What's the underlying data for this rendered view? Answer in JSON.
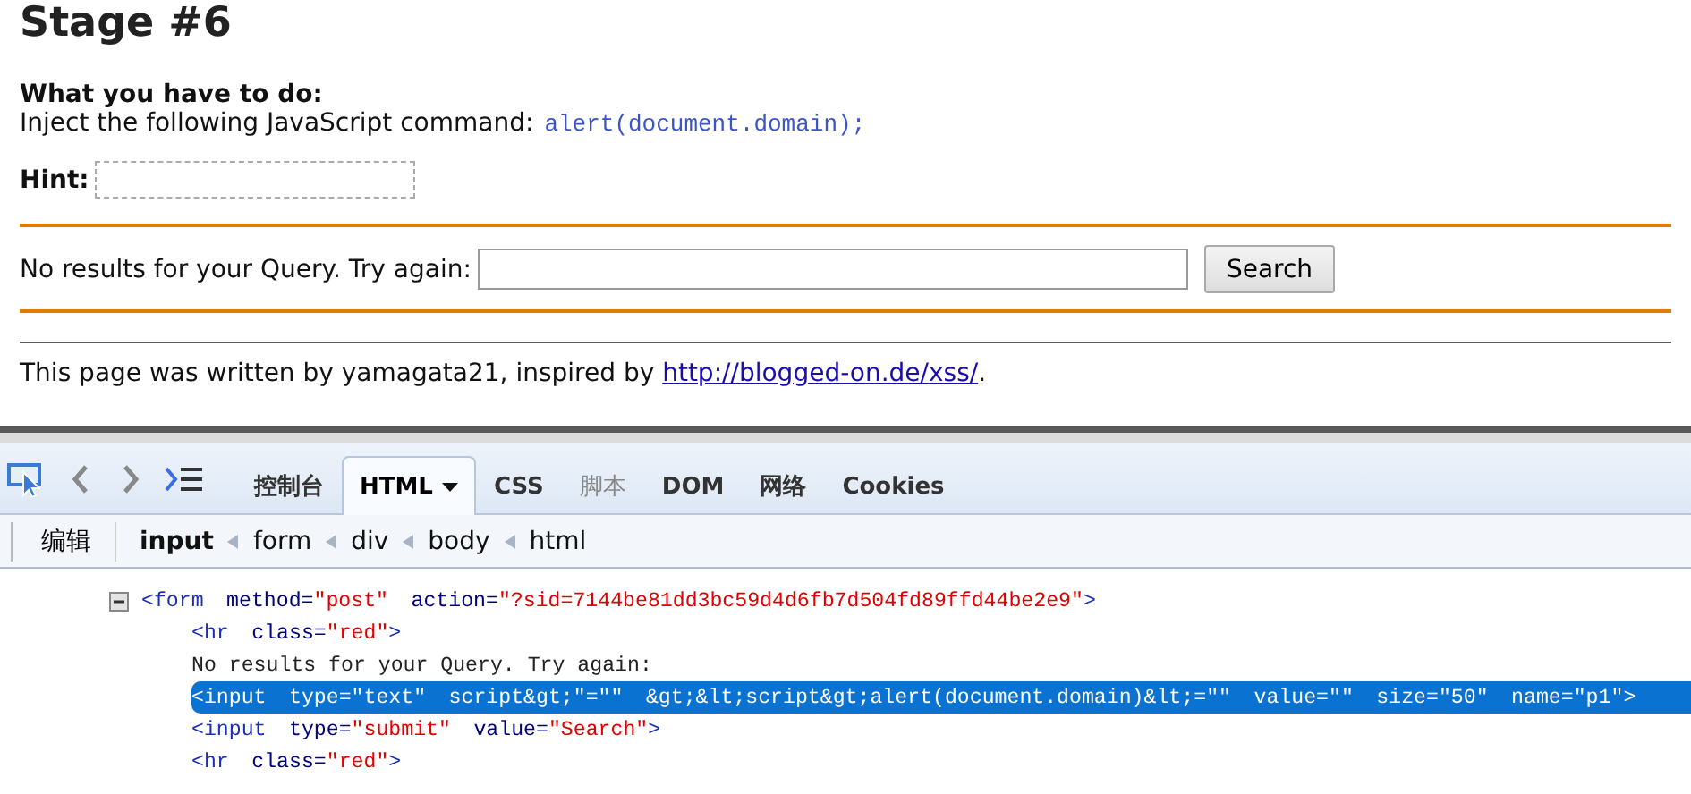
{
  "page": {
    "title": "Stage #6",
    "task_heading": "What you have to do:",
    "task_text": "Inject the following JavaScript command:",
    "task_code": "alert(document.domain);",
    "hint_label": "Hint:",
    "query_label": "No results for your Query. Try again:",
    "search_button": "Search",
    "footer_text": "This page was written by yamagata21, inspired by ",
    "footer_link": "http://blogged-on.de/xss/",
    "footer_end": "."
  },
  "devtools": {
    "tabs": [
      {
        "label": "控制台",
        "selected": false,
        "disabled": false
      },
      {
        "label": "HTML",
        "selected": true,
        "disabled": false
      },
      {
        "label": "CSS",
        "selected": false,
        "disabled": false
      },
      {
        "label": "脚本",
        "selected": false,
        "disabled": true
      },
      {
        "label": "DOM",
        "selected": false,
        "disabled": false
      },
      {
        "label": "网络",
        "selected": false,
        "disabled": false
      },
      {
        "label": "Cookies",
        "selected": false,
        "disabled": false
      }
    ],
    "edit_button": "编辑",
    "breadcrumb": [
      {
        "label": "input",
        "selected": true
      },
      {
        "label": "form",
        "selected": false
      },
      {
        "label": "div",
        "selected": false
      },
      {
        "label": "body",
        "selected": false
      },
      {
        "label": "html",
        "selected": false
      }
    ],
    "nodes": [
      {
        "expanded": true,
        "selected": false,
        "tokens": [
          {
            "kind": "tag",
            "text": "<form"
          },
          {
            "kind": "attr",
            "text": "method="
          },
          {
            "kind": "value",
            "text": "\"post\""
          },
          {
            "kind": "attr",
            "text": "action="
          },
          {
            "kind": "value",
            "text": "\"?sid=7144be81dd3bc59d4d6fb7d504fd89ffd44be2e9\""
          },
          {
            "kind": "tag",
            "text": ">"
          }
        ],
        "children": [
          {
            "selected": false,
            "tokens": [
              {
                "kind": "tag",
                "text": "<hr"
              },
              {
                "kind": "attr",
                "text": "class="
              },
              {
                "kind": "value",
                "text": "\"red\""
              },
              {
                "kind": "tag",
                "text": ">"
              }
            ]
          },
          {
            "selected": false,
            "tokens": [
              {
                "kind": "text",
                "text": "No results for your Query. Try again:"
              }
            ]
          },
          {
            "selected": true,
            "tokens": [
              {
                "kind": "tag",
                "text": "<input"
              },
              {
                "kind": "attr",
                "text": "type="
              },
              {
                "kind": "value",
                "text": "\"text\""
              },
              {
                "kind": "attr",
                "text": "script&gt;\"="
              },
              {
                "kind": "value",
                "text": "\"\""
              },
              {
                "kind": "attr",
                "text": "&gt;&lt;script&gt;alert(document.domain)&lt;="
              },
              {
                "kind": "value",
                "text": "\"\""
              },
              {
                "kind": "attr",
                "text": "value="
              },
              {
                "kind": "value",
                "text": "\"\""
              },
              {
                "kind": "attr",
                "text": "size="
              },
              {
                "kind": "value",
                "text": "\"50\""
              },
              {
                "kind": "attr",
                "text": "name="
              },
              {
                "kind": "value",
                "text": "\"p1\""
              },
              {
                "kind": "tag",
                "text": ">"
              }
            ]
          },
          {
            "selected": false,
            "tokens": [
              {
                "kind": "tag",
                "text": "<input"
              },
              {
                "kind": "attr",
                "text": "type="
              },
              {
                "kind": "value",
                "text": "\"submit\""
              },
              {
                "kind": "attr",
                "text": "value="
              },
              {
                "kind": "value",
                "text": "\"Search\""
              },
              {
                "kind": "tag",
                "text": ">"
              }
            ]
          },
          {
            "selected": false,
            "tokens": [
              {
                "kind": "tag",
                "text": "<hr"
              },
              {
                "kind": "attr",
                "text": "class="
              },
              {
                "kind": "value",
                "text": "\"red\""
              },
              {
                "kind": "tag",
                "text": ">"
              }
            ]
          }
        ]
      }
    ]
  }
}
